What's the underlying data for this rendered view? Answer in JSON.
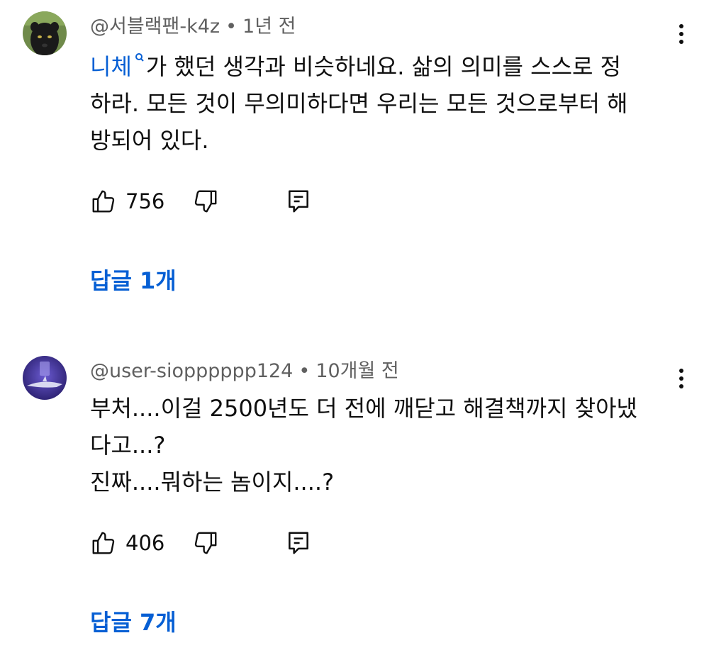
{
  "comments": [
    {
      "author": "@서블랙팬-k4z",
      "time": "1년 전",
      "separator": "•",
      "text_tag": "니체",
      "text_line1_rest": "가 했던 생각과 비슷하네요. 삶의 의미를 스스로 정",
      "text_line2": "하라. 모든 것이 무의미하다면 우리는 모든 것으로부터 해",
      "text_line3": "방되어 있다.",
      "likes": "756",
      "replies_label": "답글 1개",
      "avatar_icon": "black-panther-avatar"
    },
    {
      "author": "@user-siopppppp124",
      "time": "10개월 전",
      "separator": "•",
      "text_line1": "부처....이걸 2500년도 더 전에 깨닫고 해결책까지 찾아냈",
      "text_line2": "다고...?",
      "text_line3": "진짜....뭐하는 놈이지....?",
      "likes": "406",
      "replies_label": "답글 7개",
      "avatar_icon": "shark-avatar"
    }
  ],
  "icons": {
    "like": "thumbs-up-icon",
    "dislike": "thumbs-down-icon",
    "reply": "comment-icon",
    "menu": "more-vert-icon",
    "search": "search-icon"
  },
  "colors": {
    "link": "#065fd4",
    "meta": "#606060",
    "text": "#0f0f0f"
  }
}
